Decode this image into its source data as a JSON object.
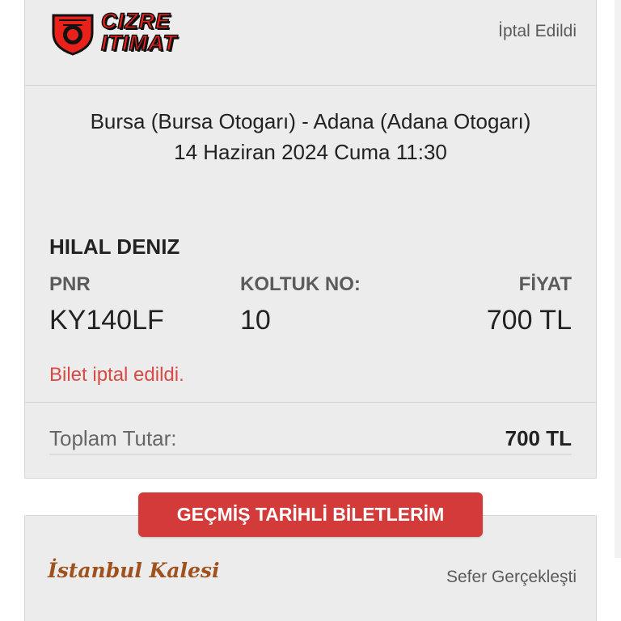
{
  "ticket": {
    "company_logo_line1": "CIZRE",
    "company_logo_line2": "ITIMAT",
    "status": "İptal Edildi",
    "route": "Bursa (Bursa Otogarı) - Adana (Adana Otogarı)",
    "datetime": "14 Haziran 2024 Cuma 11:30",
    "passenger": "HILAL DENIZ",
    "pnr_label": "PNR",
    "pnr_value": "KY140LF",
    "seat_label": "KOLTUK NO:",
    "seat_value": "10",
    "price_label": "FİYAT",
    "price_value": "700 TL",
    "cancel_message": "Bilet iptal edildi.",
    "total_label": "Toplam Tutar:",
    "total_value": "700 TL"
  },
  "history_button": {
    "label": "GEÇMİŞ TARİHLİ BİLETLERİM"
  },
  "next_ticket": {
    "company_logo": "İstanbul Kalesi",
    "status": "Sefer Gerçekleşti"
  },
  "colors": {
    "accent_red": "#d33b3a",
    "cancel_text": "#d94a44",
    "card_bg": "#ececec"
  }
}
